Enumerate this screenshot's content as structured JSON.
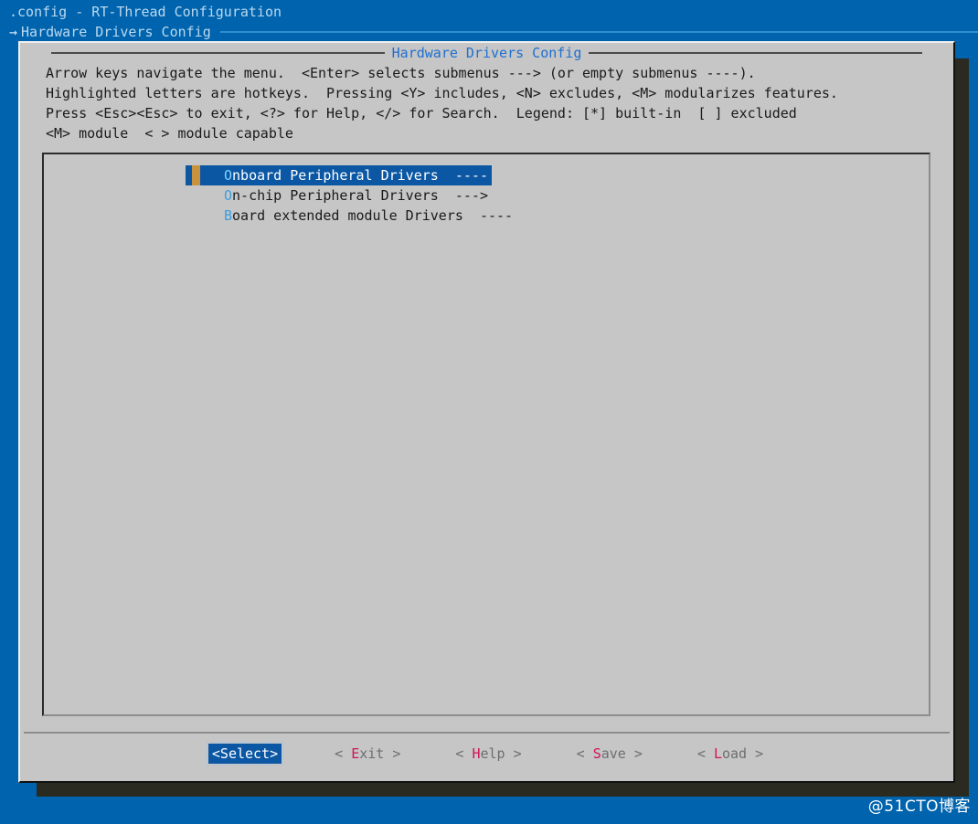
{
  "terminal": {
    "background_color": "#0063ad",
    "backtitle": ".config - RT-Thread Configuration",
    "breadcrumb": {
      "arrow": "→",
      "text": "Hardware Drivers Config"
    }
  },
  "dialog": {
    "title": "Hardware Drivers Config",
    "title_color": "#1f6fd0",
    "background_color": "#c6c6c6",
    "help_lines": [
      "Arrow keys navigate the menu.  <Enter> selects submenus ---> (or empty submenus ----).",
      "Highlighted letters are hotkeys.  Pressing <Y> includes, <N> excludes, <M> modularizes features.",
      "Press <Esc><Esc> to exit, <?> for Help, </> for Search.  Legend: [*] built-in  [ ] excluded",
      "<M> module  < > module capable"
    ],
    "menu_items": [
      {
        "hotkey": "O",
        "label_rest": "nboard Peripheral Drivers",
        "suffix": "  ----",
        "selected": true
      },
      {
        "hotkey": "O",
        "label_rest": "n-chip Peripheral Drivers",
        "suffix": "  --->",
        "selected": false
      },
      {
        "hotkey": "B",
        "label_rest": "oard extended module Drivers",
        "suffix": "  ----",
        "selected": false
      }
    ],
    "buttons": [
      {
        "prefix": "<",
        "key": "S",
        "rest": "elect>",
        "suffix": "",
        "focused": true
      },
      {
        "prefix": "< ",
        "key": "E",
        "rest": "xit",
        "suffix": " >",
        "focused": false
      },
      {
        "prefix": "< ",
        "key": "H",
        "rest": "elp",
        "suffix": " >",
        "focused": false
      },
      {
        "prefix": "< ",
        "key": "S",
        "rest": "ave",
        "suffix": " >",
        "focused": false
      },
      {
        "prefix": "< ",
        "key": "L",
        "rest": "oad",
        "suffix": " >",
        "focused": false
      }
    ],
    "selection_color": "#0b57a4",
    "hotkey_color": "#3a9fe0",
    "button_hotkey_color": "#d0145a"
  },
  "watermark": "@51CTO博客"
}
